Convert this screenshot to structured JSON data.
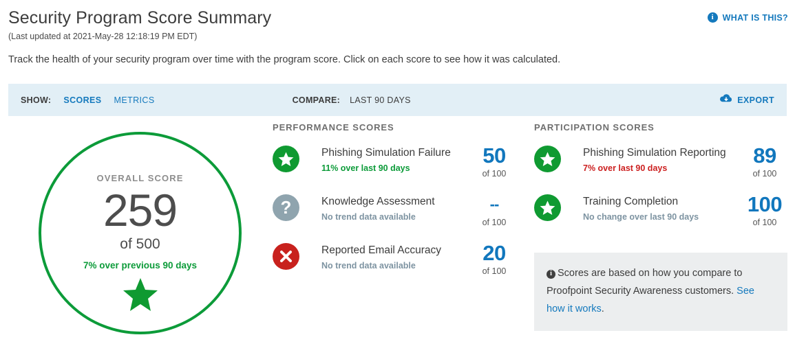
{
  "header": {
    "title": "Security Program Score Summary",
    "last_updated": "(Last updated at 2021-May-28 12:18:19 PM EDT)",
    "intro": "Track the health of your security program over time with the program score. Click on each score to see how it was calculated.",
    "what_is_this": "WHAT IS THIS?",
    "info_glyph": "i"
  },
  "filter_bar": {
    "show_label": "SHOW:",
    "show_options": [
      "SCORES",
      "METRICS"
    ],
    "show_selected": "SCORES",
    "compare_label": "COMPARE:",
    "compare_value": "LAST 90 DAYS",
    "export_label": "EXPORT"
  },
  "overall": {
    "label": "OVERALL SCORE",
    "value": "259",
    "of": "of 500",
    "trend": "7% over previous 90 days",
    "trend_direction": "up"
  },
  "performance": {
    "heading": "PERFORMANCE SCORES",
    "rows": [
      {
        "icon": "star-circle-icon",
        "icon_state": "green",
        "name": "Phishing Simulation Failure",
        "trend": "11% over last 90 days",
        "trend_state": "up",
        "value": "50",
        "of": "of 100"
      },
      {
        "icon": "question-circle-icon",
        "icon_state": "gray",
        "name": "Knowledge Assessment",
        "trend": "No trend data available",
        "trend_state": "none",
        "value": "--",
        "of": "of 100"
      },
      {
        "icon": "x-circle-icon",
        "icon_state": "red",
        "name": "Reported Email Accuracy",
        "trend": "No trend data available",
        "trend_state": "none",
        "value": "20",
        "of": "of 100"
      }
    ]
  },
  "participation": {
    "heading": "PARTICIPATION SCORES",
    "rows": [
      {
        "icon": "star-circle-icon",
        "icon_state": "green",
        "name": "Phishing Simulation Reporting",
        "trend": "7% over last 90 days",
        "trend_state": "down",
        "value": "89",
        "of": "of 100"
      },
      {
        "icon": "star-circle-icon",
        "icon_state": "green",
        "name": "Training Completion",
        "trend": "No change over last 90 days",
        "trend_state": "none",
        "value": "100",
        "of": "of 100"
      }
    ]
  },
  "note": {
    "glyph": "i",
    "text_before": "Scores are based on how you compare to Proofpoint Security Awareness customers. ",
    "link_text": "See how it works",
    "text_after": "."
  },
  "colors": {
    "accent_blue": "#1479bd",
    "score_blue": "#1177bd",
    "green": "#0c9b39",
    "red": "#c8211d",
    "gray_icon": "#8fa4ae",
    "trend_none": "#7d93a1",
    "filter_bar_bg": "#e2eff6",
    "note_bg": "#eceeef"
  }
}
